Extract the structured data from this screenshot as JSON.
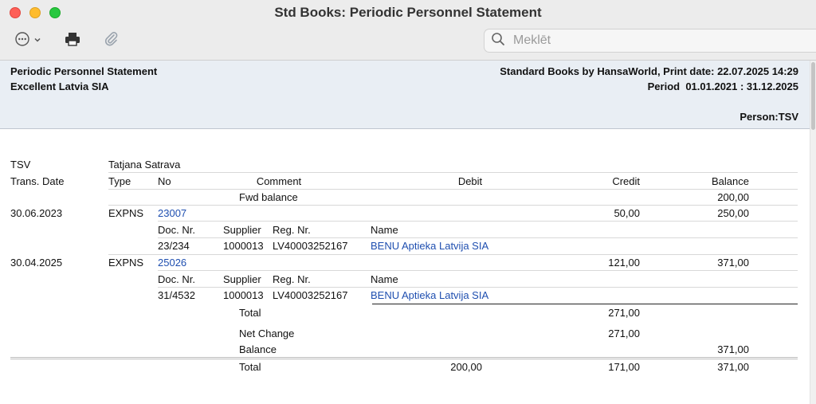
{
  "window": {
    "title": "Std Books: Periodic Personnel Statement"
  },
  "toolbar": {
    "more_icon": "ellipsis-circle-icon",
    "print_icon": "printer-icon",
    "attach_icon": "paperclip-icon"
  },
  "search": {
    "placeholder": "Meklēt",
    "value": ""
  },
  "report_header": {
    "report_name": "Periodic Personnel Statement",
    "company": "Excellent Latvia SIA",
    "print_info": "Standard Books by HansaWorld, Print date: 22.07.2025 14:29",
    "period": "Period  01.01.2021 : 31.12.2025",
    "person_filter": "Person:TSV"
  },
  "person": {
    "code": "TSV",
    "name": "Tatjana Satrava"
  },
  "columns": {
    "trans_date": "Trans. Date",
    "type": "Type",
    "no": "No",
    "comment": "Comment",
    "debit": "Debit",
    "credit": "Credit",
    "balance": "Balance"
  },
  "fwd": {
    "label": "Fwd balance",
    "balance": "200,00"
  },
  "subcolumns": {
    "doc_nr": "Doc. Nr.",
    "supplier": "Supplier",
    "reg_nr": "Reg. Nr.",
    "name": "Name"
  },
  "transactions": [
    {
      "date": "30.06.2023",
      "type": "EXPNS",
      "no": "23007",
      "credit": "50,00",
      "balance": "250,00",
      "doc_nr": "23/234",
      "supplier": "1000013",
      "reg_nr": "LV40003252167",
      "name": "BENU Aptieka Latvija SIA"
    },
    {
      "date": "30.04.2025",
      "type": "EXPNS",
      "no": "25026",
      "credit": "121,00",
      "balance": "371,00",
      "doc_nr": "31/4532",
      "supplier": "1000013",
      "reg_nr": "LV40003252167",
      "name": "BENU Aptieka Latvija SIA"
    }
  ],
  "totals": {
    "total_label": "Total",
    "total_credit": "271,00",
    "net_change_label": "Net Change",
    "net_change_credit": "271,00",
    "balance_label": "Balance",
    "balance_value": "371,00",
    "grand_label": "Total",
    "grand_debit": "200,00",
    "grand_credit": "171,00",
    "grand_balance": "371,00"
  }
}
